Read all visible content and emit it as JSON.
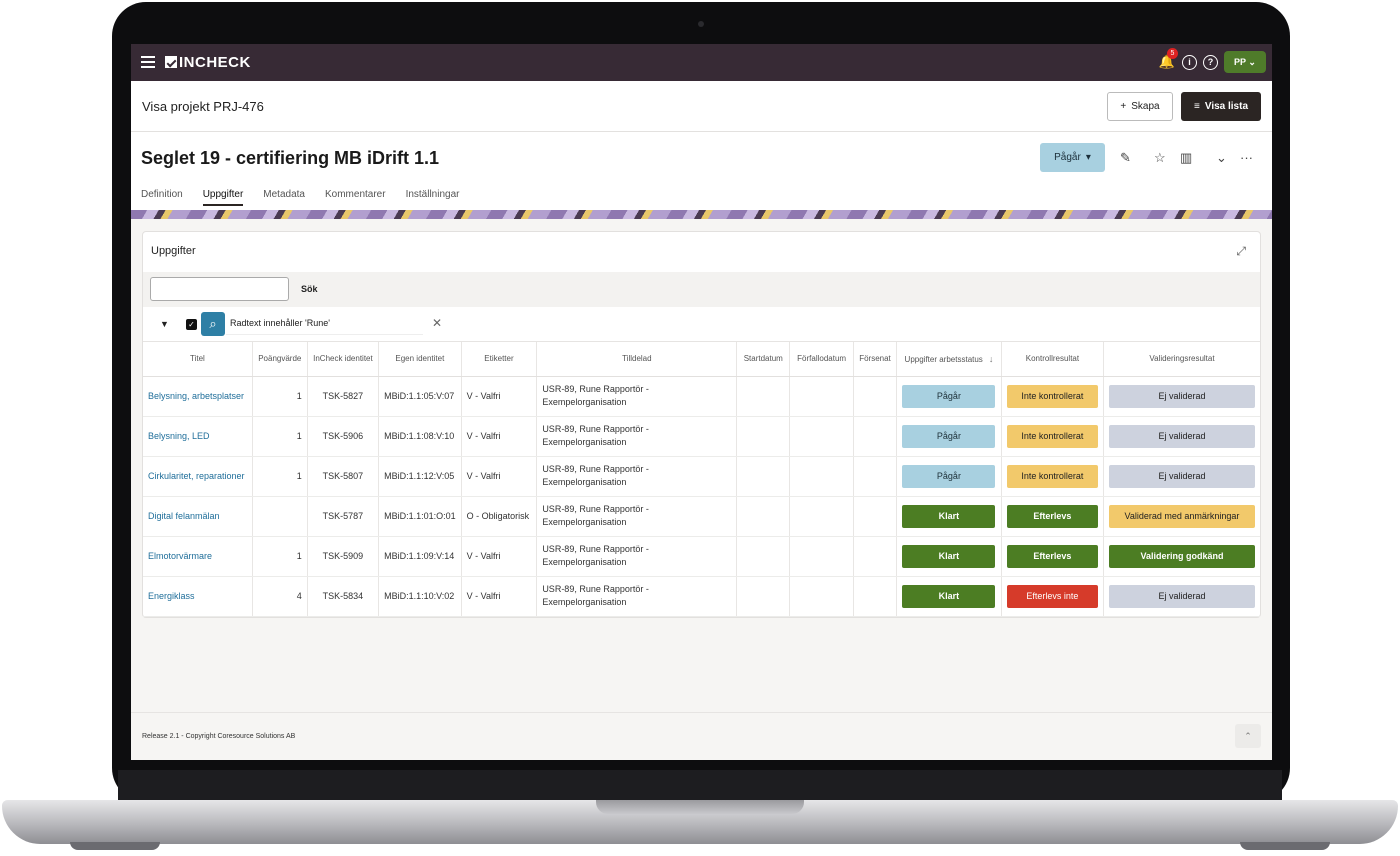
{
  "topbar": {
    "brand": "INCHECK",
    "notification_count": "5",
    "info_icon": "i",
    "help_icon": "?",
    "user_initials": "PP"
  },
  "header": {
    "title": "Visa projekt PRJ-476",
    "create_label": "Skapa",
    "list_label": "Visa lista"
  },
  "project": {
    "title": "Seglet 19 - certifiering MB iDrift 1.1",
    "status": "Pågår"
  },
  "tabs": [
    "Definition",
    "Uppgifter",
    "Metadata",
    "Kommentarer",
    "Inställningar"
  ],
  "panel": {
    "title": "Uppgifter",
    "search_button": "Sök",
    "filter_text": "Radtext innehåller 'Rune'"
  },
  "columns": [
    "Titel",
    "Poängvärde",
    "InCheck identitet",
    "Egen identitet",
    "Etiketter",
    "Tilldelad",
    "Startdatum",
    "Förfallodatum",
    "Försenat",
    "Uppgifter arbetsstatus",
    "Kontrollresultat",
    "Valideringsresultat"
  ],
  "colors": {
    "topbar": "#372a35",
    "pagar": "#a8d0e0",
    "klart": "#4c7d23",
    "warn": "#f2c96b",
    "grey": "#cdd2de",
    "danger": "#d63b2a"
  },
  "rows": [
    {
      "title": "Belysning, arbetsplatser",
      "points": "1",
      "incheck_id": "TSK-5827",
      "own_id": "MBiD:1.1:05:V:07",
      "tags": "V - Valfri",
      "assigned": "USR-89, Rune Rapportör - Exempelorganisation",
      "start": "",
      "due": "",
      "late": "",
      "work_status": "Pågår",
      "work_kind": "pagar",
      "control": "Inte kontrollerat",
      "control_kind": "warn",
      "validation": "Ej validerad",
      "validation_kind": "grey"
    },
    {
      "title": "Belysning, LED",
      "points": "1",
      "incheck_id": "TSK-5906",
      "own_id": "MBiD:1.1:08:V:10",
      "tags": "V - Valfri",
      "assigned": "USR-89, Rune Rapportör - Exempelorganisation",
      "start": "",
      "due": "",
      "late": "",
      "work_status": "Pågår",
      "work_kind": "pagar",
      "control": "Inte kontrollerat",
      "control_kind": "warn",
      "validation": "Ej validerad",
      "validation_kind": "grey"
    },
    {
      "title": "Cirkularitet, reparationer",
      "points": "1",
      "incheck_id": "TSK-5807",
      "own_id": "MBiD:1.1:12:V:05",
      "tags": "V - Valfri",
      "assigned": "USR-89, Rune Rapportör - Exempelorganisation",
      "start": "",
      "due": "",
      "late": "",
      "work_status": "Pågår",
      "work_kind": "pagar",
      "control": "Inte kontrollerat",
      "control_kind": "warn",
      "validation": "Ej validerad",
      "validation_kind": "grey"
    },
    {
      "title": "Digital felanmälan",
      "points": "",
      "incheck_id": "TSK-5787",
      "own_id": "MBiD:1.1:01:O:01",
      "tags": "O - Obligatorisk",
      "assigned": "USR-89, Rune Rapportör - Exempelorganisation",
      "start": "",
      "due": "",
      "late": "",
      "work_status": "Klart",
      "work_kind": "klart",
      "control": "Efterlevs",
      "control_kind": "klart",
      "validation": "Validerad med anmärkningar",
      "validation_kind": "warn"
    },
    {
      "title": "Elmotorvärmare",
      "points": "1",
      "incheck_id": "TSK-5909",
      "own_id": "MBiD:1.1:09:V:14",
      "tags": "V - Valfri",
      "assigned": "USR-89, Rune Rapportör - Exempelorganisation",
      "start": "",
      "due": "",
      "late": "",
      "work_status": "Klart",
      "work_kind": "klart",
      "control": "Efterlevs",
      "control_kind": "klart",
      "validation": "Validering godkänd",
      "validation_kind": "klart"
    },
    {
      "title": "Energiklass",
      "points": "4",
      "incheck_id": "TSK-5834",
      "own_id": "MBiD:1.1:10:V:02",
      "tags": "V - Valfri",
      "assigned": "USR-89, Rune Rapportör - Exempelorganisation",
      "start": "",
      "due": "",
      "late": "",
      "work_status": "Klart",
      "work_kind": "klart",
      "control": "Efterlevs inte",
      "control_kind": "danger",
      "validation": "Ej validerad",
      "validation_kind": "grey"
    }
  ],
  "footer": {
    "text": "Release 2.1 - Copyright Coresource Solutions AB"
  }
}
